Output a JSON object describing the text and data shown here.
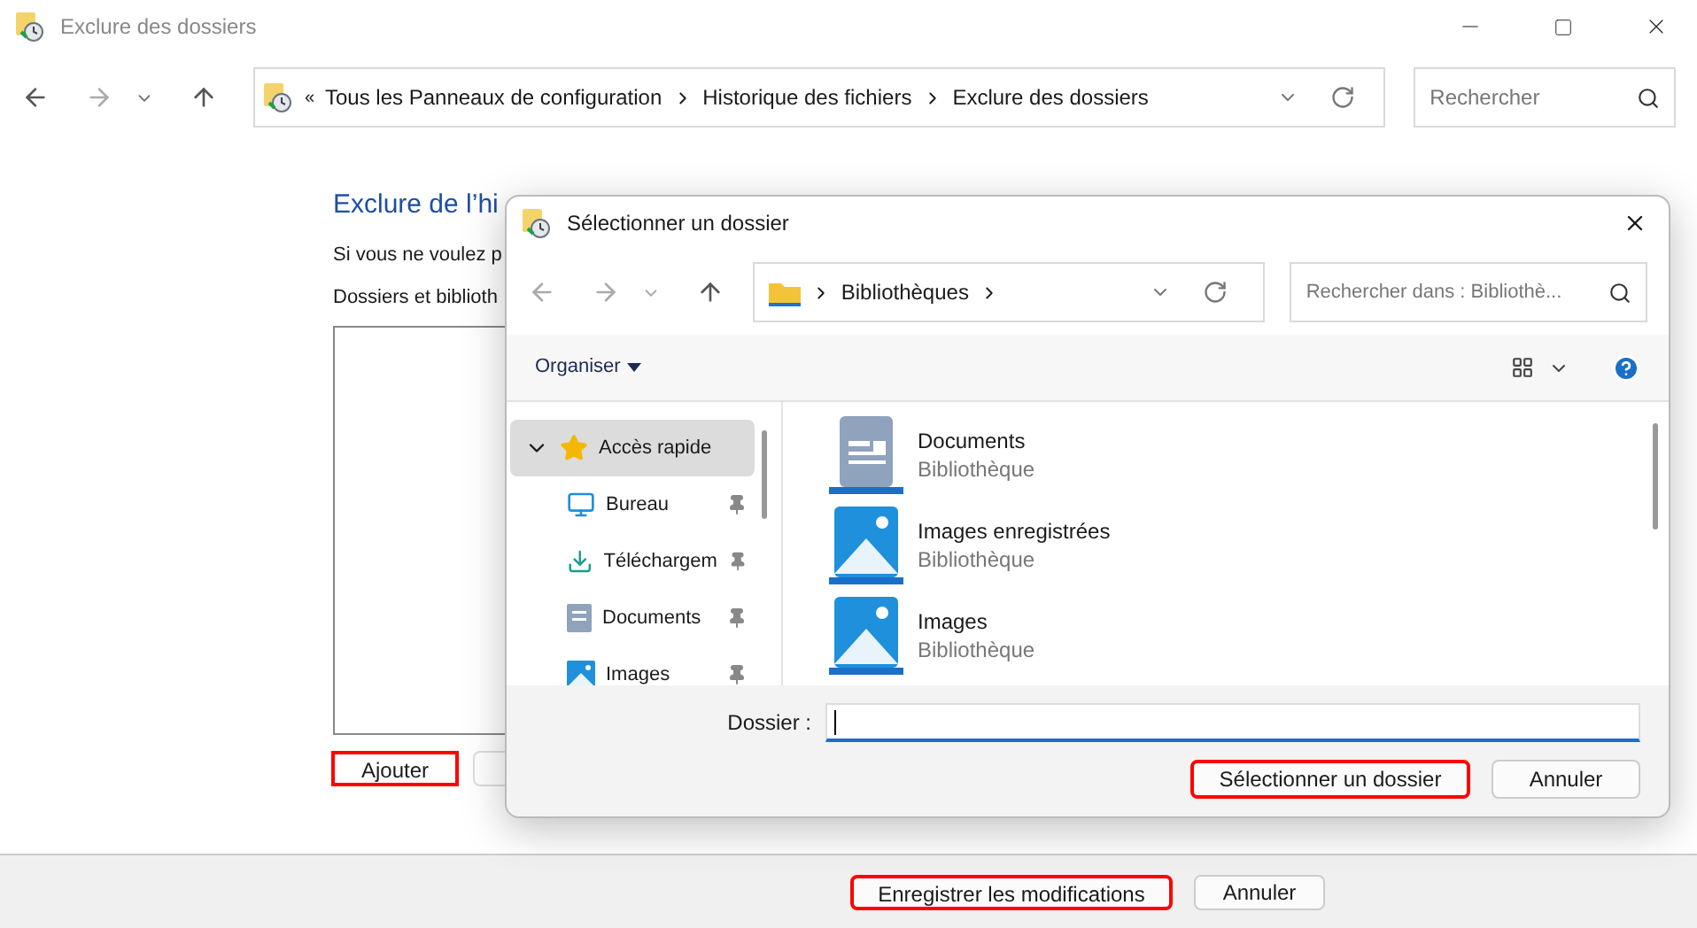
{
  "window": {
    "title": "Exclure des dossiers"
  },
  "address_bar": {
    "overflow": "«",
    "crumbs": [
      "Tous les Panneaux de configuration",
      "Historique des fichiers",
      "Exclure des dossiers"
    ]
  },
  "search": {
    "placeholder": "Rechercher"
  },
  "content": {
    "heading": "Exclure de l’hi",
    "intro": "Si vous ne voulez p",
    "list_label": "Dossiers et biblioth"
  },
  "add_button": {
    "label": "Ajouter",
    "highlighted": true
  },
  "footer_buttons": [
    {
      "label": "Enregistrer les modifications",
      "highlighted": true
    },
    {
      "label": "Annuler",
      "highlighted": false
    }
  ],
  "dialog": {
    "title": "Sélectionner un dossier",
    "address": {
      "crumbs": [
        "Bibliothèques"
      ]
    },
    "search": {
      "placeholder": "Rechercher dans : Bibliothè..."
    },
    "organize": "Organiser",
    "nav": [
      {
        "label": "Accès rapide",
        "kind": "star",
        "selected": true,
        "children": [
          {
            "label": "Bureau",
            "kind": "desktop",
            "selected": false,
            "pinned": true
          },
          {
            "label": "Téléchargem",
            "kind": "download",
            "selected": false,
            "pinned": true
          },
          {
            "label": "Documents",
            "kind": "document",
            "selected": false,
            "pinned": true
          },
          {
            "label": "Images",
            "kind": "image",
            "selected": false,
            "pinned": true
          }
        ]
      }
    ],
    "items": [
      {
        "name": "Documents",
        "type": "Bibliothèque",
        "kind": "document"
      },
      {
        "name": "Images enregistrées",
        "type": "Bibliothèque",
        "kind": "image"
      },
      {
        "name": "Images",
        "type": "Bibliothèque",
        "kind": "image"
      }
    ],
    "folder_label": "Dossier :",
    "buttons": [
      {
        "label": "Sélectionner un dossier",
        "highlighted": true
      },
      {
        "label": "Annuler",
        "highlighted": false
      }
    ]
  }
}
